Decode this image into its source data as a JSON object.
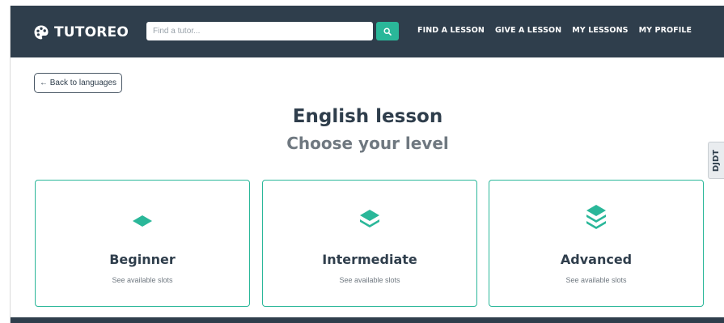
{
  "navbar": {
    "brand": "TUTOREO",
    "search_placeholder": "Find a tutor...",
    "links": [
      "FIND A LESSON",
      "GIVE A LESSON",
      "MY LESSONS",
      "MY PROFILE"
    ]
  },
  "back_label": "← Back to languages",
  "title": "English lesson",
  "subtitle": "Choose your level",
  "side_tab": "DJDT",
  "levels": [
    {
      "name": "Beginner",
      "sub": "See available slots"
    },
    {
      "name": "Intermediate",
      "sub": "See available slots"
    },
    {
      "name": "Advanced",
      "sub": "See available slots"
    }
  ],
  "colors": {
    "navbar": "#2f3e4c",
    "accent": "#2ab799",
    "text_dark": "#2f3e4c",
    "text_muted": "#6f7880"
  },
  "icons": {
    "brand": "palette-icon",
    "search": "search-icon",
    "level": "layers-icon"
  }
}
